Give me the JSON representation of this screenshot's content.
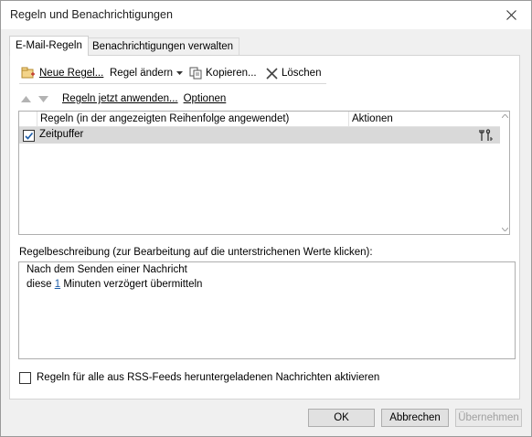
{
  "window": {
    "title": "Regeln und Benachrichtigungen"
  },
  "tabs": [
    {
      "label": "E-Mail-Regeln",
      "active": true
    },
    {
      "label": "Benachrichtigungen verwalten",
      "active": false
    }
  ],
  "toolbar": {
    "new_rule": "Neue Regel...",
    "change_rule": "Regel ändern",
    "copy": "Kopieren...",
    "delete": "Löschen"
  },
  "toolbar2": {
    "apply_now": "Regeln jetzt anwenden...",
    "options": "Optionen"
  },
  "rules_list": {
    "columns": [
      "Regeln (in der angezeigten Reihenfolge angewendet)",
      "Aktionen"
    ],
    "rows": [
      {
        "name": "Zeitpuffer",
        "checked": true
      }
    ]
  },
  "description": {
    "label": "Regelbeschreibung (zur Bearbeitung auf die unterstrichenen Werte klicken):",
    "line1": "Nach dem Senden einer Nachricht",
    "line2_prefix": "diese",
    "line2_link": "1",
    "line2_suffix": "Minuten verzögert übermitteln"
  },
  "rss_option": {
    "label": "Regeln für alle aus RSS-Feeds heruntergeladenen Nachrichten aktivieren",
    "checked": false
  },
  "buttons": {
    "ok": "OK",
    "cancel": "Abbrechen",
    "apply": "Übernehmen"
  },
  "colors": {
    "accent": "#1f5ea8",
    "selected_row": "#d9d9d9"
  }
}
